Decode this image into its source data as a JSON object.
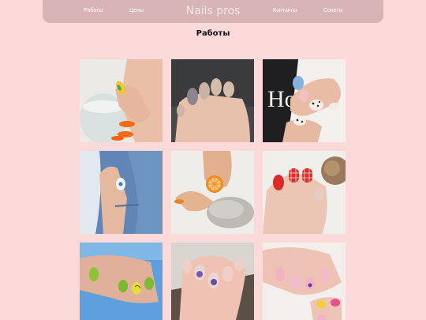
{
  "nav": {
    "links_left": [
      "Работы",
      "Цены"
    ],
    "brand": "Nails pros",
    "links_right": [
      "Контакты",
      "Советы"
    ]
  },
  "gallery": {
    "title": "Работы",
    "photos": [
      {
        "subject": "hand-glass-orange-nails"
      },
      {
        "subject": "grey-nude-nails"
      },
      {
        "subject": "blue-leopard-nails"
      },
      {
        "subject": "hand-in-jeans-pocket"
      },
      {
        "subject": "orange-slice-nail"
      },
      {
        "subject": "red-plaid-nails"
      },
      {
        "subject": "green-lime-nails"
      },
      {
        "subject": "purple-flower-nails"
      },
      {
        "subject": "pink-dessert-nails"
      }
    ]
  }
}
